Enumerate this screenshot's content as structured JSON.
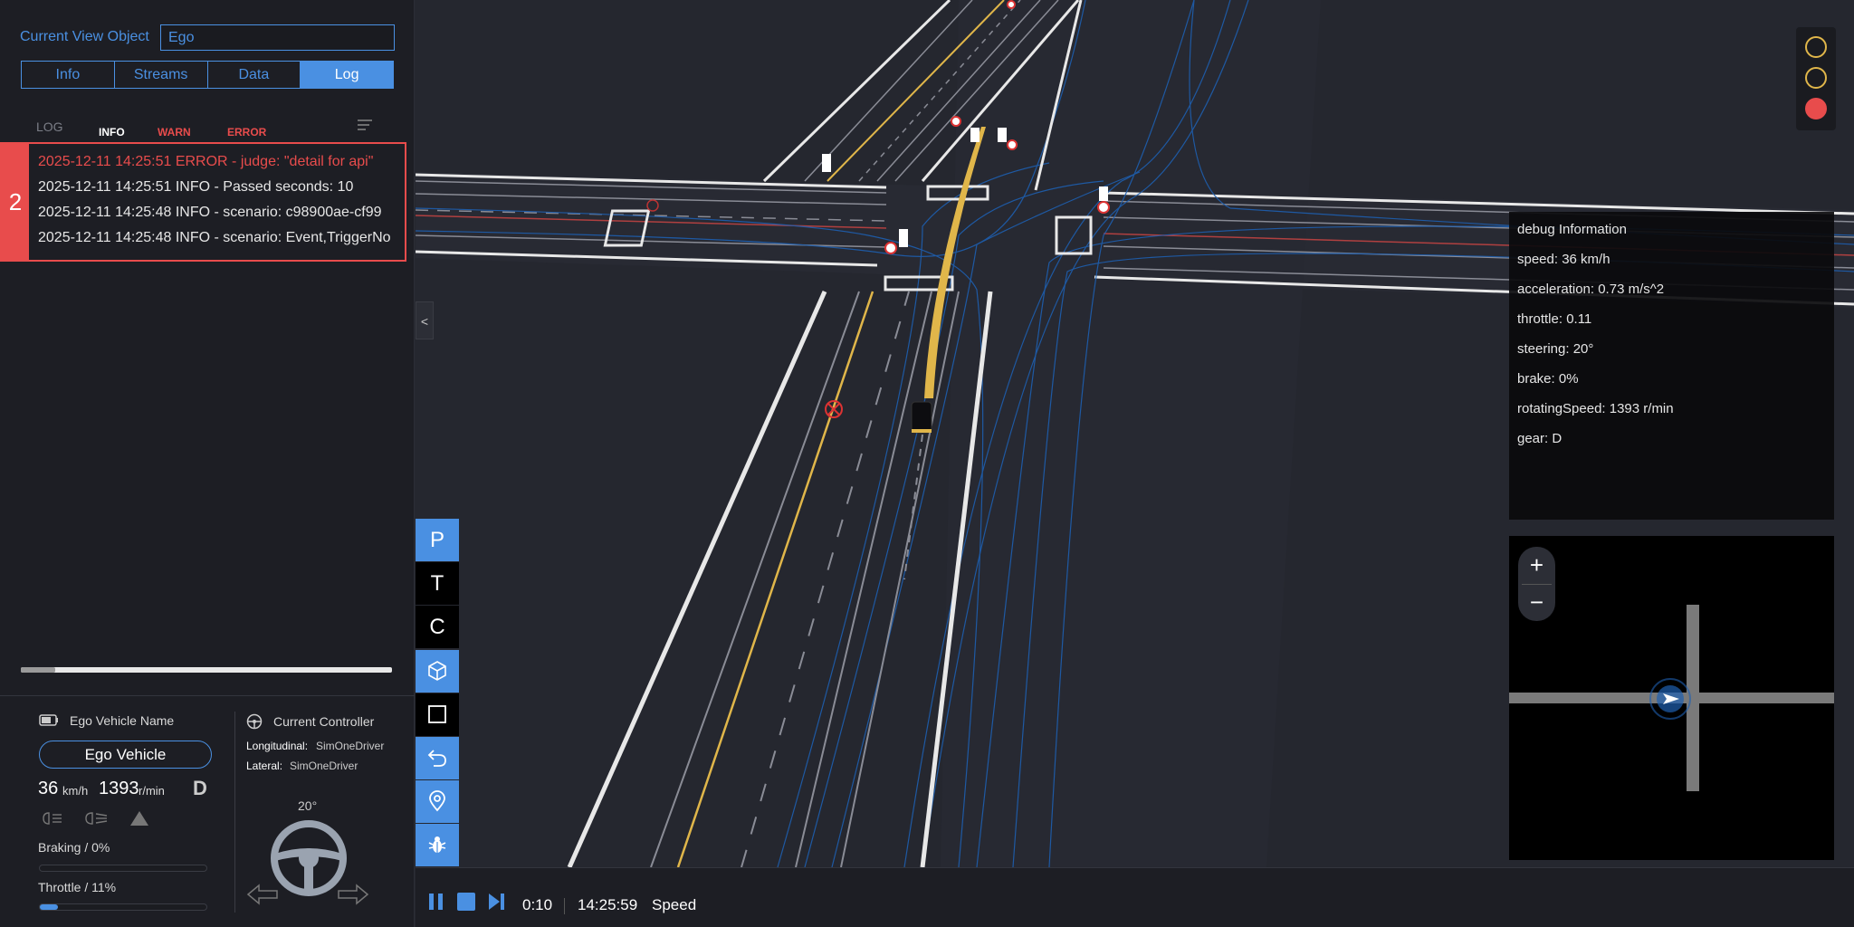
{
  "current_view": {
    "label": "Current View Object",
    "value": "Ego"
  },
  "tabs": [
    {
      "label": "Info"
    },
    {
      "label": "Streams"
    },
    {
      "label": "Data"
    },
    {
      "label": "Log"
    }
  ],
  "log": {
    "header": "LOG",
    "levels": {
      "info": "INFO",
      "warn": "WARN",
      "error": "ERROR"
    },
    "count": "2",
    "lines": [
      "2025-12-11 14:25:51 ERROR - judge: \"detail for api\"",
      "2025-12-11 14:25:51 INFO - Passed seconds: 10",
      "2025-12-11 14:25:48 INFO - scenario: c98900ae-cf99",
      "2025-12-11 14:25:48 INFO - scenario: Event,TriggerNo"
    ]
  },
  "ego": {
    "name_label": "Ego Vehicle Name",
    "name_value": "Ego Vehicle",
    "speed": "36",
    "speed_unit": "km/h",
    "rpm": "1393",
    "rpm_unit": "r/min",
    "gear": "D",
    "braking_label": "Braking / 0%",
    "braking_fraction": 0,
    "throttle_label": "Throttle / 11%",
    "throttle_fraction": 0.11
  },
  "controller": {
    "title": "Current Controller",
    "longitudinal_label": "Longitudinal:",
    "longitudinal_value": "SimOneDriver",
    "lateral_label": "Lateral:",
    "lateral_value": "SimOneDriver",
    "steering_angle": "20°"
  },
  "toolbar": {
    "p": "P",
    "t": "T",
    "c": "C",
    "icons": [
      "cube-icon",
      "square-icon",
      "undo-icon",
      "location-pin-icon",
      "bug-icon"
    ]
  },
  "traffic_lights": [
    "yellow-outline",
    "yellow-outline",
    "red"
  ],
  "debug": {
    "title": "debug Information",
    "speed": "speed: 36 km/h",
    "acceleration": "acceleration: 0.73 m/s^2",
    "throttle": "throttle: 0.11",
    "steering": "steering: 20°",
    "brake": "brake: 0%",
    "rotating_speed": "rotatingSpeed: 1393 r/min",
    "gear": "gear: D"
  },
  "minimap": {
    "zoom_in": "+",
    "zoom_out": "−"
  },
  "collapse": "<",
  "playback": {
    "elapsed": "0:10",
    "clock": "14:25:59",
    "mode": "Speed"
  },
  "colors": {
    "accent": "#4a90e2",
    "error": "#e84c4c",
    "lane_yellow": "#e0b64a"
  }
}
